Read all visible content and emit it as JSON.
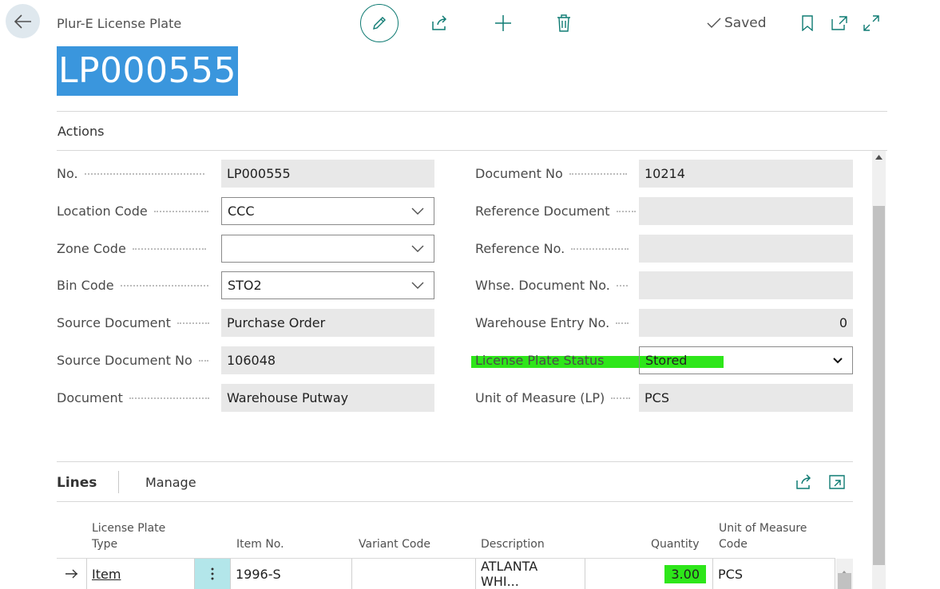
{
  "header": {
    "caption": "Plur-E License Plate",
    "title": "LP000555",
    "saved_label": "Saved"
  },
  "actions_label": "Actions",
  "fields_left": [
    {
      "label": "No.",
      "value": "LP000555",
      "kind": "readonly"
    },
    {
      "label": "Location Code",
      "value": "CCC",
      "kind": "select"
    },
    {
      "label": "Zone Code",
      "value": "",
      "kind": "select"
    },
    {
      "label": "Bin Code",
      "value": "STO2",
      "kind": "select"
    },
    {
      "label": "Source Document",
      "value": "Purchase Order",
      "kind": "readonly"
    },
    {
      "label": "Source Document No",
      "value": "106048",
      "kind": "readonly"
    },
    {
      "label": "Document",
      "value": "Warehouse Putway",
      "kind": "readonly"
    }
  ],
  "fields_right": [
    {
      "label": "Document No",
      "value": "10214",
      "kind": "readonly"
    },
    {
      "label": "Reference Document",
      "value": "",
      "kind": "readonly"
    },
    {
      "label": "Reference No.",
      "value": "",
      "kind": "readonly"
    },
    {
      "label": "Whse. Document No.",
      "value": "",
      "kind": "readonly"
    },
    {
      "label": "Warehouse Entry No.",
      "value": "0",
      "kind": "number"
    },
    {
      "label": "License Plate Status",
      "value": "Stored",
      "kind": "dropdown"
    },
    {
      "label": "Unit of Measure (LP)",
      "value": "PCS",
      "kind": "readonly"
    }
  ],
  "lines": {
    "title": "Lines",
    "manage_label": "Manage",
    "columns": {
      "type_line1": "License Plate",
      "type_line2": "Type",
      "item_no": "Item No.",
      "variant_code": "Variant Code",
      "description": "Description",
      "quantity": "Quantity",
      "uom_line1": "Unit of Measure",
      "uom_line2": "Code"
    },
    "rows": [
      {
        "type": "Item",
        "item_no": "1996-S",
        "variant_code": "",
        "description": "ATLANTA WHI...",
        "quantity": "3.00",
        "uom": "PCS"
      }
    ]
  },
  "colors": {
    "accent": "#0f7b73",
    "title_highlight": "#3a96dd",
    "marker_highlight": "#2ee61a",
    "selected_cell": "#b3e6ea"
  }
}
